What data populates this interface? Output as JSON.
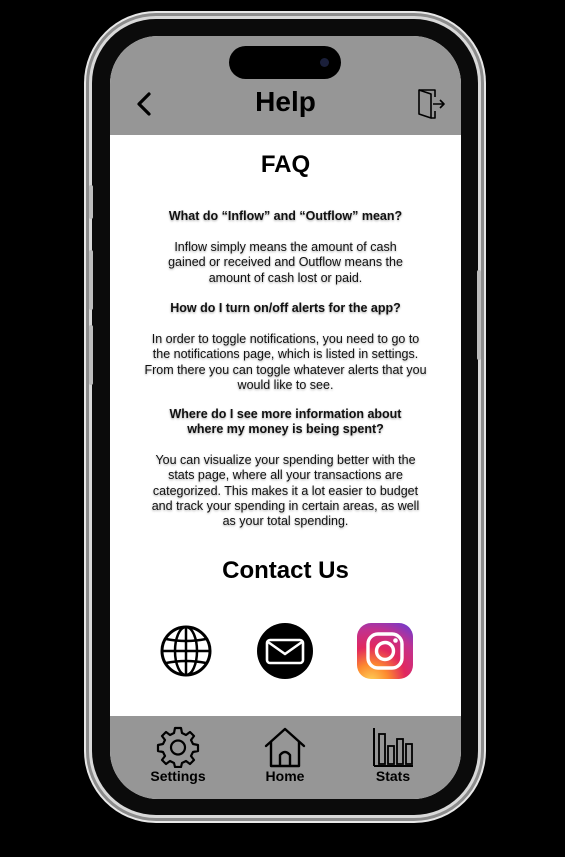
{
  "header": {
    "title": "Help"
  },
  "faq": {
    "title": "FAQ",
    "items": [
      {
        "question": "What do “Inflow” and “Outflow” mean?",
        "answer": "Inflow simply means the amount of cash gained or received and Outflow means the amount of cash lost or paid."
      },
      {
        "question": "How do I turn on/off alerts for the app?",
        "answer": "In order to toggle notifications, you need to go to the notifications page, which is listed in settings. From there you can toggle whatever alerts that you would like to see."
      },
      {
        "question": "Where do I see more information about where my money is being spent?",
        "answer": "You can visualize your spending better with the stats page, where all your transactions are categorized. This makes it a lot easier to budget and track your spending in certain areas, as well as your total spending."
      }
    ]
  },
  "contact": {
    "title": "Contact Us",
    "icons": [
      "globe-icon",
      "mail-icon",
      "instagram-icon"
    ]
  },
  "nav": {
    "items": [
      {
        "label": "Settings",
        "icon": "gear-icon"
      },
      {
        "label": "Home",
        "icon": "home-icon"
      },
      {
        "label": "Stats",
        "icon": "bar-chart-icon"
      }
    ]
  },
  "colors": {
    "bar_gray": "#969696",
    "background": "#000000",
    "content": "#ffffff"
  }
}
